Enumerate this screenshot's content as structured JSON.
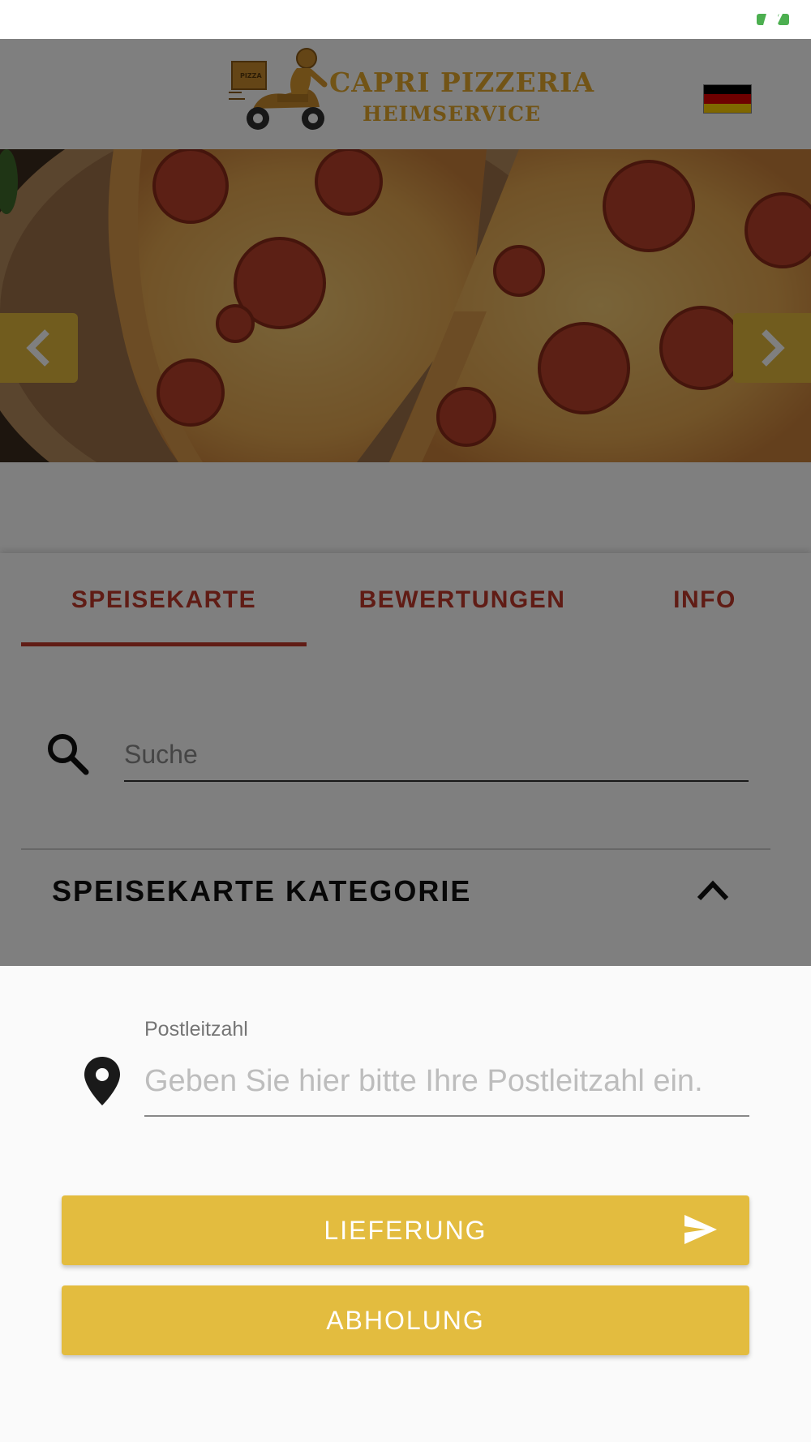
{
  "colors": {
    "accent": "#c0392b",
    "brand_gold": "#e3bc3f",
    "logo_gold": "#e5a92c",
    "status_green": "#4caf50"
  },
  "status_bar": {
    "battery_icon": "battery-charging-icon"
  },
  "header": {
    "logo_line1": "CAPRI PIZZERIA",
    "logo_line2": "HEIMSERVICE",
    "logo_badge": "PIZZA",
    "language_flag": "german-flag-icon"
  },
  "hero": {
    "image": "pepperoni-pizza-photo",
    "prev_icon": "chevron-left-icon",
    "next_icon": "chevron-right-icon"
  },
  "tabs": [
    {
      "label": "SPEISEKARTE",
      "active": true
    },
    {
      "label": "BEWERTUNGEN",
      "active": false
    },
    {
      "label": "INFO",
      "active": false
    }
  ],
  "search": {
    "placeholder": "Suche",
    "icon": "search-icon"
  },
  "category": {
    "title": "SPEISEKARTE KATEGORIE",
    "icon": "chevron-up-icon"
  },
  "delivery_sheet": {
    "postcode_label": "Postleitzahl",
    "postcode_placeholder": "Geben Sie hier bitte Ihre Postleitzahl ein.",
    "postcode_icon": "map-pin-icon",
    "delivery_button": "LIEFERUNG",
    "delivery_icon": "send-icon",
    "pickup_button": "ABHOLUNG"
  }
}
